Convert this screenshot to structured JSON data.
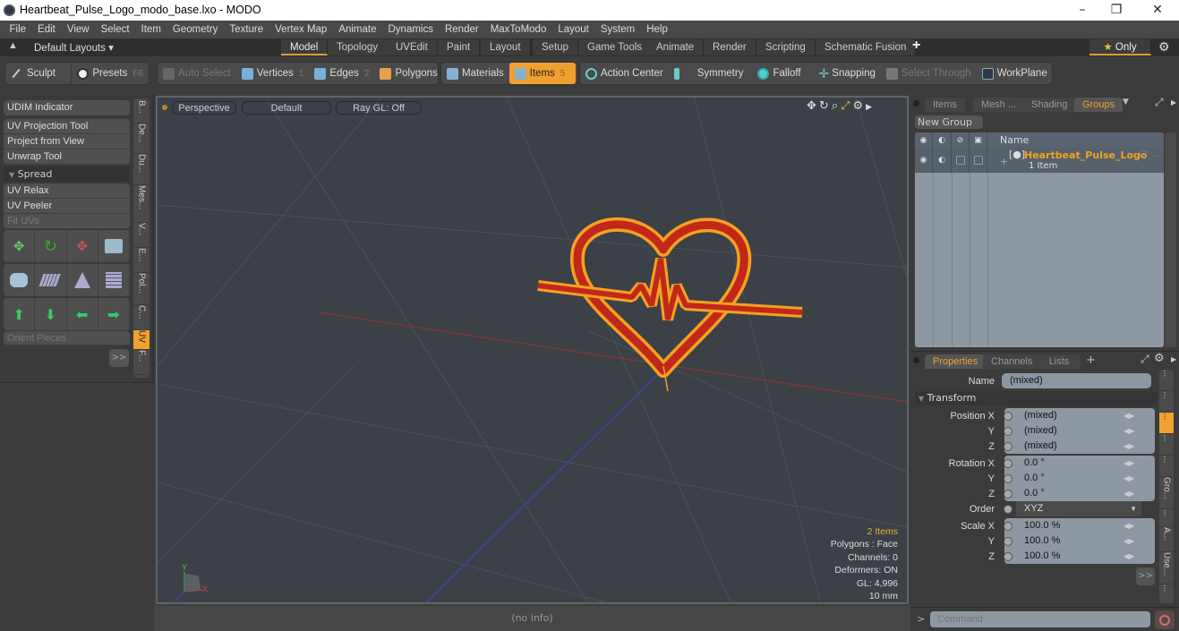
{
  "window": {
    "title": "Heartbeat_Pulse_Logo_modo_base.lxo - MODO",
    "minimize": "–",
    "maximize": "❐",
    "close": "✕"
  },
  "menu": [
    "File",
    "Edit",
    "View",
    "Select",
    "Item",
    "Geometry",
    "Texture",
    "Vertex Map",
    "Animate",
    "Dynamics",
    "Render",
    "MaxToModo",
    "Layout",
    "System",
    "Help"
  ],
  "layouts": {
    "dropdown": "Default Layouts ▾",
    "tabs": [
      "Model",
      "Topology",
      "UVEdit",
      "Paint",
      "Layout",
      "Setup",
      "Game Tools",
      "Animate",
      "Render",
      "Scripting",
      "Schematic Fusion"
    ],
    "active": "Model",
    "add": "+",
    "only_label": "Only",
    "star": "★"
  },
  "toolbar": {
    "sculpt": "Sculpt",
    "presets": "Presets",
    "presets_key": "F6",
    "auto_select": "Auto Select",
    "vertices": "Vertices",
    "vertices_key": "1",
    "edges": "Edges",
    "edges_key": "2",
    "polygons": "Polygons",
    "materials": "Materials",
    "items": "Items",
    "items_key": "5",
    "action_center": "Action Center",
    "symmetry": "Symmetry",
    "falloff": "Falloff",
    "snapping": "Snapping",
    "select_through": "Select Through",
    "workplane": "WorkPlane"
  },
  "left_panel": {
    "udim": "UDIM Indicator",
    "tools": [
      "UV Projection Tool",
      "Project from View",
      "Unwrap Tool"
    ],
    "spread_section": "Spread",
    "spread_tools": [
      "UV Relax",
      "UV Peeler",
      "Fit UVs"
    ],
    "orient_pieces": "Orient Pieces",
    "more": ">>",
    "vertical_tabs": [
      "B...",
      "De...",
      "Du...",
      "Mes...",
      "V...",
      "E...",
      "Pol...",
      "C...",
      "UV",
      "F..."
    ],
    "active_tab": "UV"
  },
  "viewport": {
    "view": "Perspective",
    "shading": "Default",
    "raygl": "Ray GL: Off",
    "stats": {
      "items": "2 Items",
      "polygons": "Polygons : Face",
      "channels": "Channels: 0",
      "deformers": "Deformers: ON",
      "gl": "GL: 4,996",
      "scale": "10 mm"
    },
    "axis": {
      "x": "X",
      "y": "Y",
      "z": "Z"
    }
  },
  "status": "(no info)",
  "groups_panel": {
    "tabs": [
      "Items",
      "Mesh ...",
      "Shading",
      "Groups"
    ],
    "active": "Groups",
    "new_group": "New Group",
    "col_name": "Name",
    "group_name": "Heartbeat_Pulse_Logo",
    "group_suffix": "(2 ...",
    "group_count": "1 Item",
    "expand": "+"
  },
  "properties_panel": {
    "tabs": [
      "Properties",
      "Channels",
      "Lists"
    ],
    "active": "Properties",
    "add": "+",
    "name_label": "Name",
    "name_value": "(mixed)",
    "section": "Transform",
    "position": {
      "label_x": "Position X",
      "x": "(mixed)",
      "y": "(mixed)",
      "z": "(mixed)"
    },
    "rotation": {
      "label_x": "Rotation X",
      "x": "0.0 °",
      "y": "0.0 °",
      "z": "0.0 °"
    },
    "order_label": "Order",
    "order_value": "XYZ",
    "scale": {
      "label_x": "Scale X",
      "x": "100.0 %",
      "y": "100.0 %",
      "z": "100.0 %"
    },
    "axis_y": "Y",
    "axis_z": "Z",
    "more": ">>",
    "side_tabs": [
      "...",
      "...",
      "...",
      "...",
      "Gro...",
      "...",
      "A...",
      "Use...",
      "..."
    ]
  },
  "command": {
    "prompt": ">",
    "placeholder": "Command"
  },
  "colors": {
    "accent": "#f0a030",
    "selection_orange": "#f5a020",
    "mesh_red": "#c0281a",
    "viewport_bg": "#3b4147"
  }
}
